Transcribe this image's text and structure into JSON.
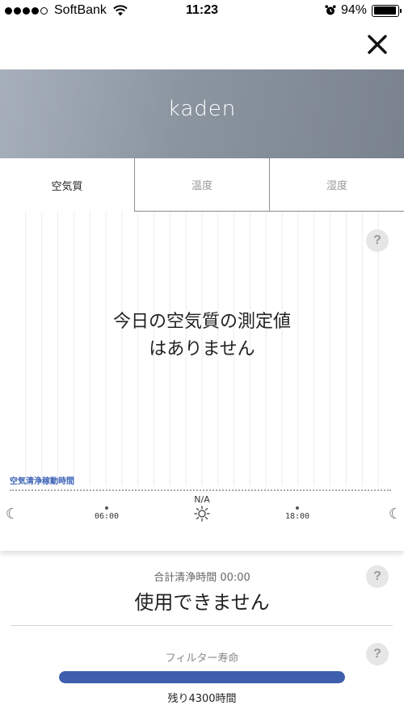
{
  "status_bar": {
    "carrier": "SoftBank",
    "time": "11:23",
    "battery_text": "94%",
    "battery_level": 0.94,
    "signal_bars": 4,
    "signal_total": 5
  },
  "header": {
    "title": "kaden"
  },
  "tabs": [
    {
      "label": "空気質",
      "active": true
    },
    {
      "label": "温度",
      "active": false
    },
    {
      "label": "湿度",
      "active": false
    }
  ],
  "chart": {
    "help_text": "?",
    "no_data_message": "今日の空気質の測定値はありません",
    "operation_label": "空気清浄稼動時間",
    "times": [
      "06:00",
      "18:00"
    ],
    "na_text": "N/A"
  },
  "summary": {
    "total_label": "合計清浄時間 00:00",
    "status": "使用できません",
    "help_text": "?",
    "filter_label": "フィルター寿命",
    "filter_level": 1.0,
    "remaining": "残り4300時間",
    "filter_help_text": "?"
  },
  "colors": {
    "banner": "#8b95a0",
    "accent": "#3e5fae",
    "operation_label": "#3c63b6"
  }
}
